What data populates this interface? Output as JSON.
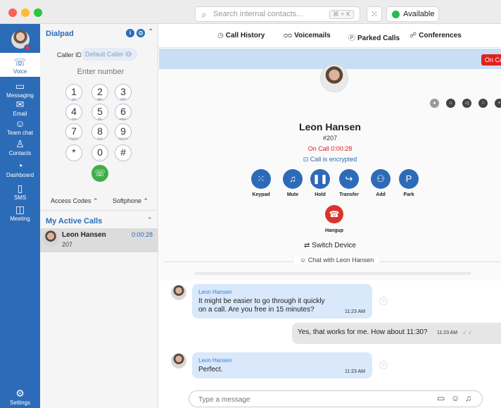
{
  "titlebar": {
    "search": {
      "placeholder": "Search internal contacts...",
      "shortcut": "⌘ + K"
    },
    "status": {
      "label": "Available",
      "color": "#2db84d"
    }
  },
  "nav": {
    "items": [
      {
        "id": "voice",
        "label": "Voice",
        "icon": "phone-icon",
        "glyph": "☏",
        "active": true
      },
      {
        "id": "messaging",
        "label": "Messaging",
        "icon": "chat-icon",
        "glyph": "▭"
      },
      {
        "id": "email",
        "label": "Email",
        "icon": "envelope-icon",
        "glyph": "✉"
      },
      {
        "id": "team-chat",
        "label": "Team chat",
        "icon": "team-chat-icon",
        "glyph": "☺"
      },
      {
        "id": "contacts",
        "label": "Contacts",
        "icon": "contacts-icon",
        "glyph": "♙"
      },
      {
        "id": "dashboard",
        "label": "Dashboard",
        "icon": "dashboard-icon",
        "glyph": "◔"
      },
      {
        "id": "sms",
        "label": "SMS",
        "icon": "sms-icon",
        "glyph": "▯"
      },
      {
        "id": "meeting",
        "label": "Meeting",
        "icon": "meeting-icon",
        "glyph": "◫"
      }
    ],
    "settings": {
      "label": "Settings",
      "icon": "gear-icon",
      "glyph": "⚙"
    }
  },
  "dialpad": {
    "title": "Dialpad",
    "caller_id_label": "Caller ID",
    "caller_id_value": "Default Caller ID",
    "number_placeholder": "Enter number",
    "keys": [
      {
        "digit": "1",
        "letters": "QO"
      },
      {
        "digit": "2",
        "letters": "ABC"
      },
      {
        "digit": "3",
        "letters": "DEF"
      },
      {
        "digit": "4",
        "letters": "GHI"
      },
      {
        "digit": "5",
        "letters": "JKL"
      },
      {
        "digit": "6",
        "letters": "MNO"
      },
      {
        "digit": "7",
        "letters": "PQRS"
      },
      {
        "digit": "8",
        "letters": "TUV"
      },
      {
        "digit": "9",
        "letters": "WXYZ"
      },
      {
        "digit": "*",
        "letters": ""
      },
      {
        "digit": "0",
        "letters": "+"
      },
      {
        "digit": "#",
        "letters": ""
      }
    ],
    "access_codes": "Access Codes ⌃",
    "softphone": "Softphone ⌃"
  },
  "active_calls": {
    "title": "My Active Calls",
    "calls": [
      {
        "name": "Leon Hansen",
        "ext": "207",
        "duration": "0:00:28"
      }
    ]
  },
  "tabs": [
    {
      "label": "Call History",
      "icon": "clock-icon",
      "glyph": "◷"
    },
    {
      "label": "Voicemails",
      "icon": "voicemail-icon",
      "glyph": "ᴑᴑ"
    },
    {
      "label": "Parked Calls",
      "icon": "parked-icon",
      "glyph": "Ⓟ"
    },
    {
      "label": "Conferences",
      "icon": "conference-icon",
      "glyph": "☍"
    }
  ],
  "call": {
    "badge": "On Call",
    "name": "Leon Hansen",
    "ext": "#207",
    "status": "On Call 0:00:28",
    "encrypted": "Call is encrypted",
    "actions": [
      {
        "label": "Keypad",
        "icon": "keypad-icon",
        "glyph": "⁙"
      },
      {
        "label": "Mute",
        "icon": "microphone-icon",
        "glyph": "♫"
      },
      {
        "label": "Hold",
        "icon": "pause-icon",
        "glyph": "❚❚"
      },
      {
        "label": "Transfer",
        "icon": "transfer-icon",
        "glyph": "↪"
      },
      {
        "label": "Add",
        "icon": "add-user-icon",
        "glyph": "⚇"
      },
      {
        "label": "Park",
        "icon": "park-icon",
        "glyph": "P"
      }
    ],
    "hangup_label": "Hangup",
    "switch_device": "⇄ Switch Device"
  },
  "chat": {
    "title": "Chat with Leon Hansen",
    "messages": [
      {
        "direction": "in",
        "sender": "Leon Hansen",
        "lines": [
          "It might be easier to go through it quickly",
          "on a call. Are you free in 15 minutes?"
        ],
        "time": "11:23 AM"
      },
      {
        "direction": "out",
        "text": "Yes, that works for me. How about 11:30?",
        "time": "11:23 AM"
      },
      {
        "direction": "in",
        "sender": "Leon Hansen",
        "lines": [
          "Perfect."
        ],
        "time": "11:23 AM"
      }
    ],
    "composer_placeholder": "Type a message"
  }
}
